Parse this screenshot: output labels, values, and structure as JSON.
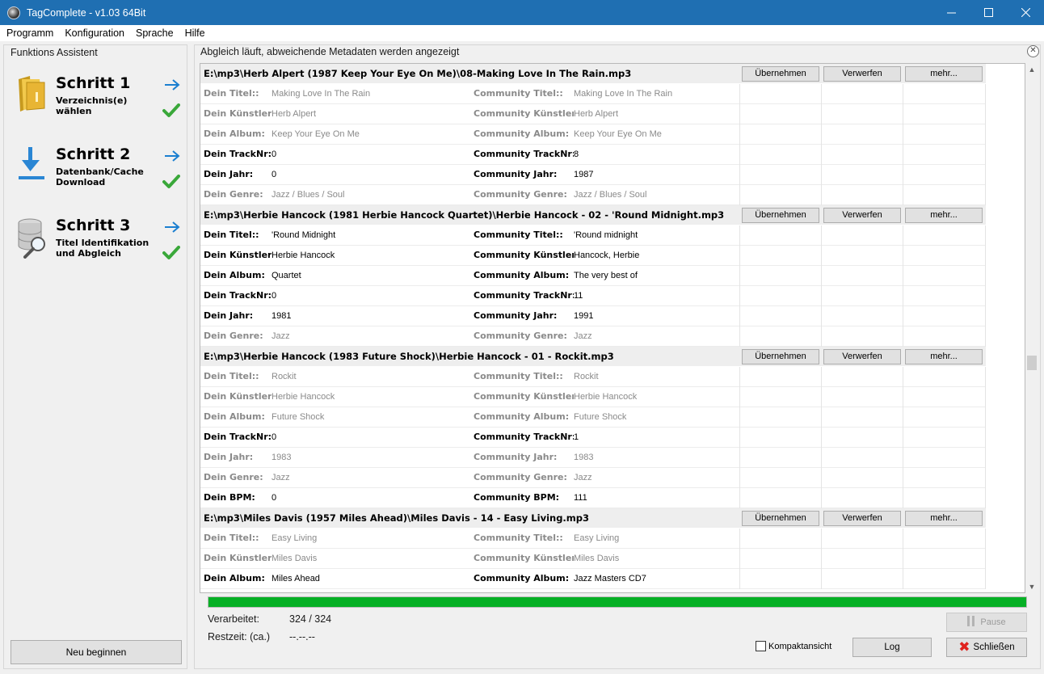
{
  "window": {
    "title": "TagComplete - v1.03 64Bit"
  },
  "menu": [
    "Programm",
    "Konfiguration",
    "Sprache",
    "Hilfe"
  ],
  "assistant": {
    "title": "Funktions Assistent",
    "steps": [
      {
        "title": "Schritt 1",
        "desc": "Verzeichnis(e)\nwählen",
        "icon": "folder-icon"
      },
      {
        "title": "Schritt 2",
        "desc": "Datenbank/Cache\nDownload",
        "icon": "download-icon"
      },
      {
        "title": "Schritt 3",
        "desc": "Titel Identifikation\nund Abgleich",
        "icon": "database-search-icon"
      }
    ],
    "restart_label": "Neu beginnen"
  },
  "status": {
    "title": "Abgleich läuft, abweichende Metadaten werden angezeigt"
  },
  "buttons": {
    "apply": "Übernehmen",
    "discard": "Verwerfen",
    "more": "mehr..."
  },
  "rows": [
    {
      "type": "file",
      "text": "E:\\mp3\\Herb Alpert (1987 Keep Your Eye On Me)\\08-Making Love In The Rain.mp3"
    },
    {
      "type": "field",
      "muted": true,
      "l1": "Dein Titel::",
      "v1": "Making Love In The Rain",
      "l2": "Community Titel::",
      "v2": "Making Love In The Rain"
    },
    {
      "type": "field",
      "muted": true,
      "l1": "Dein Künstler:",
      "v1": "Herb Alpert",
      "l2": "Community Künstler:",
      "v2": "Herb Alpert"
    },
    {
      "type": "field",
      "muted": true,
      "l1": "Dein Album:",
      "v1": "Keep Your Eye On Me",
      "l2": "Community Album:",
      "v2": "Keep Your Eye On Me"
    },
    {
      "type": "field",
      "muted": false,
      "l1": "Dein TrackNr:",
      "v1": "0",
      "l2": "Community TrackNr:",
      "v2": "8"
    },
    {
      "type": "field",
      "muted": false,
      "l1": "Dein Jahr:",
      "v1": "0",
      "l2": "Community Jahr:",
      "v2": "1987"
    },
    {
      "type": "field",
      "muted": true,
      "l1": "Dein Genre:",
      "v1": "Jazz / Blues / Soul",
      "l2": "Community Genre:",
      "v2": "Jazz / Blues / Soul"
    },
    {
      "type": "file",
      "text": "E:\\mp3\\Herbie Hancock (1981 Herbie Hancock Quartet)\\Herbie Hancock - 02 - 'Round Midnight.mp3"
    },
    {
      "type": "field",
      "muted": false,
      "l1": "Dein Titel::",
      "v1": "'Round Midnight",
      "l2": "Community Titel::",
      "v2": "'Round midnight"
    },
    {
      "type": "field",
      "muted": false,
      "l1": "Dein Künstler:",
      "v1": "Herbie Hancock",
      "l2": "Community Künstler:",
      "v2": "Hancock, Herbie"
    },
    {
      "type": "field",
      "muted": false,
      "l1": "Dein Album:",
      "v1": "Quartet",
      "l2": "Community Album:",
      "v2": "The very best of"
    },
    {
      "type": "field",
      "muted": false,
      "l1": "Dein TrackNr:",
      "v1": "0",
      "l2": "Community TrackNr:",
      "v2": "11"
    },
    {
      "type": "field",
      "muted": false,
      "l1": "Dein Jahr:",
      "v1": "1981",
      "l2": "Community Jahr:",
      "v2": "1991"
    },
    {
      "type": "field",
      "muted": true,
      "l1": "Dein Genre:",
      "v1": "Jazz",
      "l2": "Community Genre:",
      "v2": "Jazz"
    },
    {
      "type": "file",
      "text": "E:\\mp3\\Herbie Hancock (1983 Future Shock)\\Herbie Hancock - 01 - Rockit.mp3"
    },
    {
      "type": "field",
      "muted": true,
      "l1": "Dein Titel::",
      "v1": "Rockit",
      "l2": "Community Titel::",
      "v2": "Rockit"
    },
    {
      "type": "field",
      "muted": true,
      "l1": "Dein Künstler:",
      "v1": "Herbie Hancock",
      "l2": "Community Künstler:",
      "v2": "Herbie Hancock"
    },
    {
      "type": "field",
      "muted": true,
      "l1": "Dein Album:",
      "v1": "Future Shock",
      "l2": "Community Album:",
      "v2": "Future Shock"
    },
    {
      "type": "field",
      "muted": false,
      "l1": "Dein TrackNr:",
      "v1": "0",
      "l2": "Community TrackNr:",
      "v2": "1"
    },
    {
      "type": "field",
      "muted": true,
      "l1": "Dein Jahr:",
      "v1": "1983",
      "l2": "Community Jahr:",
      "v2": "1983"
    },
    {
      "type": "field",
      "muted": true,
      "l1": "Dein Genre:",
      "v1": "Jazz",
      "l2": "Community Genre:",
      "v2": "Jazz"
    },
    {
      "type": "field",
      "muted": false,
      "l1": "Dein BPM:",
      "v1": "0",
      "l2": "Community BPM:",
      "v2": "111"
    },
    {
      "type": "file",
      "text": "E:\\mp3\\Miles Davis (1957 Miles Ahead)\\Miles Davis - 14 - Easy Living.mp3"
    },
    {
      "type": "field",
      "muted": true,
      "l1": "Dein Titel::",
      "v1": "Easy Living",
      "l2": "Community Titel::",
      "v2": "Easy Living"
    },
    {
      "type": "field",
      "muted": true,
      "l1": "Dein Künstler:",
      "v1": "Miles Davis",
      "l2": "Community Künstler:",
      "v2": "Miles Davis"
    },
    {
      "type": "field",
      "muted": false,
      "l1": "Dein Album:",
      "v1": "Miles Ahead",
      "l2": "Community Album:",
      "v2": "Jazz Masters CD7"
    }
  ],
  "progress": {
    "fraction": 1.0,
    "processed_label": "Verarbeitet:",
    "processed_value": "324 / 324",
    "remaining_label": "Restzeit: (ca.)",
    "remaining_value": "--.--.--"
  },
  "bottom": {
    "pause_label": "Pause",
    "compact_label": "Kompaktansicht",
    "compact_checked": false,
    "log_label": "Log",
    "close_label": "Schließen"
  },
  "colors": {
    "titlebar": "#1f6fb2",
    "progress": "#06b025",
    "arrow": "#1b7fd0",
    "check": "#3aa83a",
    "close_x": "#e0221d"
  }
}
